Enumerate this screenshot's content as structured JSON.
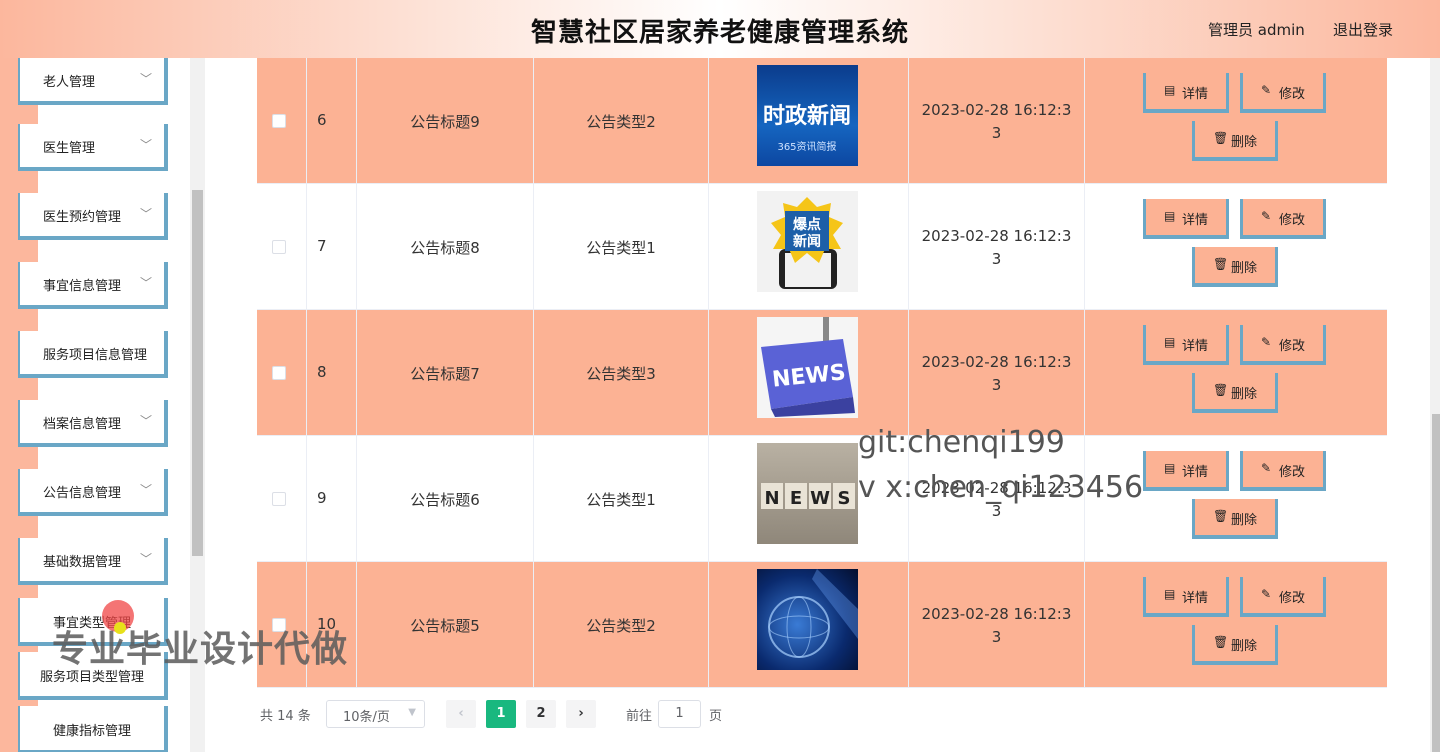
{
  "header": {
    "title": "智慧社区居家养老健康管理系统",
    "user": "管理员 admin",
    "logout": "退出登录"
  },
  "sidebar": {
    "items": [
      {
        "label": "老人管理",
        "chevron": true
      },
      {
        "label": "医生管理",
        "chevron": true
      },
      {
        "label": "医生预约管理",
        "chevron": true
      },
      {
        "label": "事宜信息管理",
        "chevron": true
      },
      {
        "label": "服务项目信息管理",
        "chevron": false
      },
      {
        "label": "档案信息管理",
        "chevron": true
      },
      {
        "label": "公告信息管理",
        "chevron": true
      },
      {
        "label": "基础数据管理",
        "chevron": true
      }
    ],
    "sub_items": [
      {
        "label": "事宜类型管理"
      },
      {
        "label": "服务项目类型管理"
      },
      {
        "label": "健康指标管理"
      }
    ]
  },
  "table": {
    "rows": [
      {
        "index": "6",
        "title": "公告标题9",
        "type": "公告类型2",
        "time": "2023-02-28 16:12:33",
        "image": "时政新闻 365资讯简报"
      },
      {
        "index": "7",
        "title": "公告标题8",
        "type": "公告类型1",
        "time": "2023-02-28 16:12:33",
        "image": "爆点新闻"
      },
      {
        "index": "8",
        "title": "公告标题7",
        "type": "公告类型3",
        "time": "2023-02-28 16:12:33",
        "image": "NEWS"
      },
      {
        "index": "9",
        "title": "公告标题6",
        "type": "公告类型1",
        "time": "2023-02-28 16:12:33",
        "image": "NEWS"
      },
      {
        "index": "10",
        "title": "公告标题5",
        "type": "公告类型2",
        "time": "2023-02-28 16:12:33",
        "image": "globe"
      }
    ],
    "actions": {
      "detail": "详情",
      "edit": "修改",
      "delete": "删除"
    }
  },
  "pagination": {
    "total": "共 14 条",
    "page_size": "10条/页",
    "pages": [
      "1",
      "2"
    ],
    "current": "1",
    "goto_label": "前往",
    "goto_value": "1",
    "goto_unit": "页",
    "prev": "‹",
    "next": "›"
  },
  "watermarks": {
    "line1": "git:chenqi199",
    "line2": "v x:chen_qi123456",
    "line3": "专业毕业设计代做"
  },
  "colors": {
    "header_accent": "#fcb79d",
    "row_highlight": "#fcb294",
    "border_blue": "#6aa7c6",
    "page_active": "#19b87f"
  }
}
